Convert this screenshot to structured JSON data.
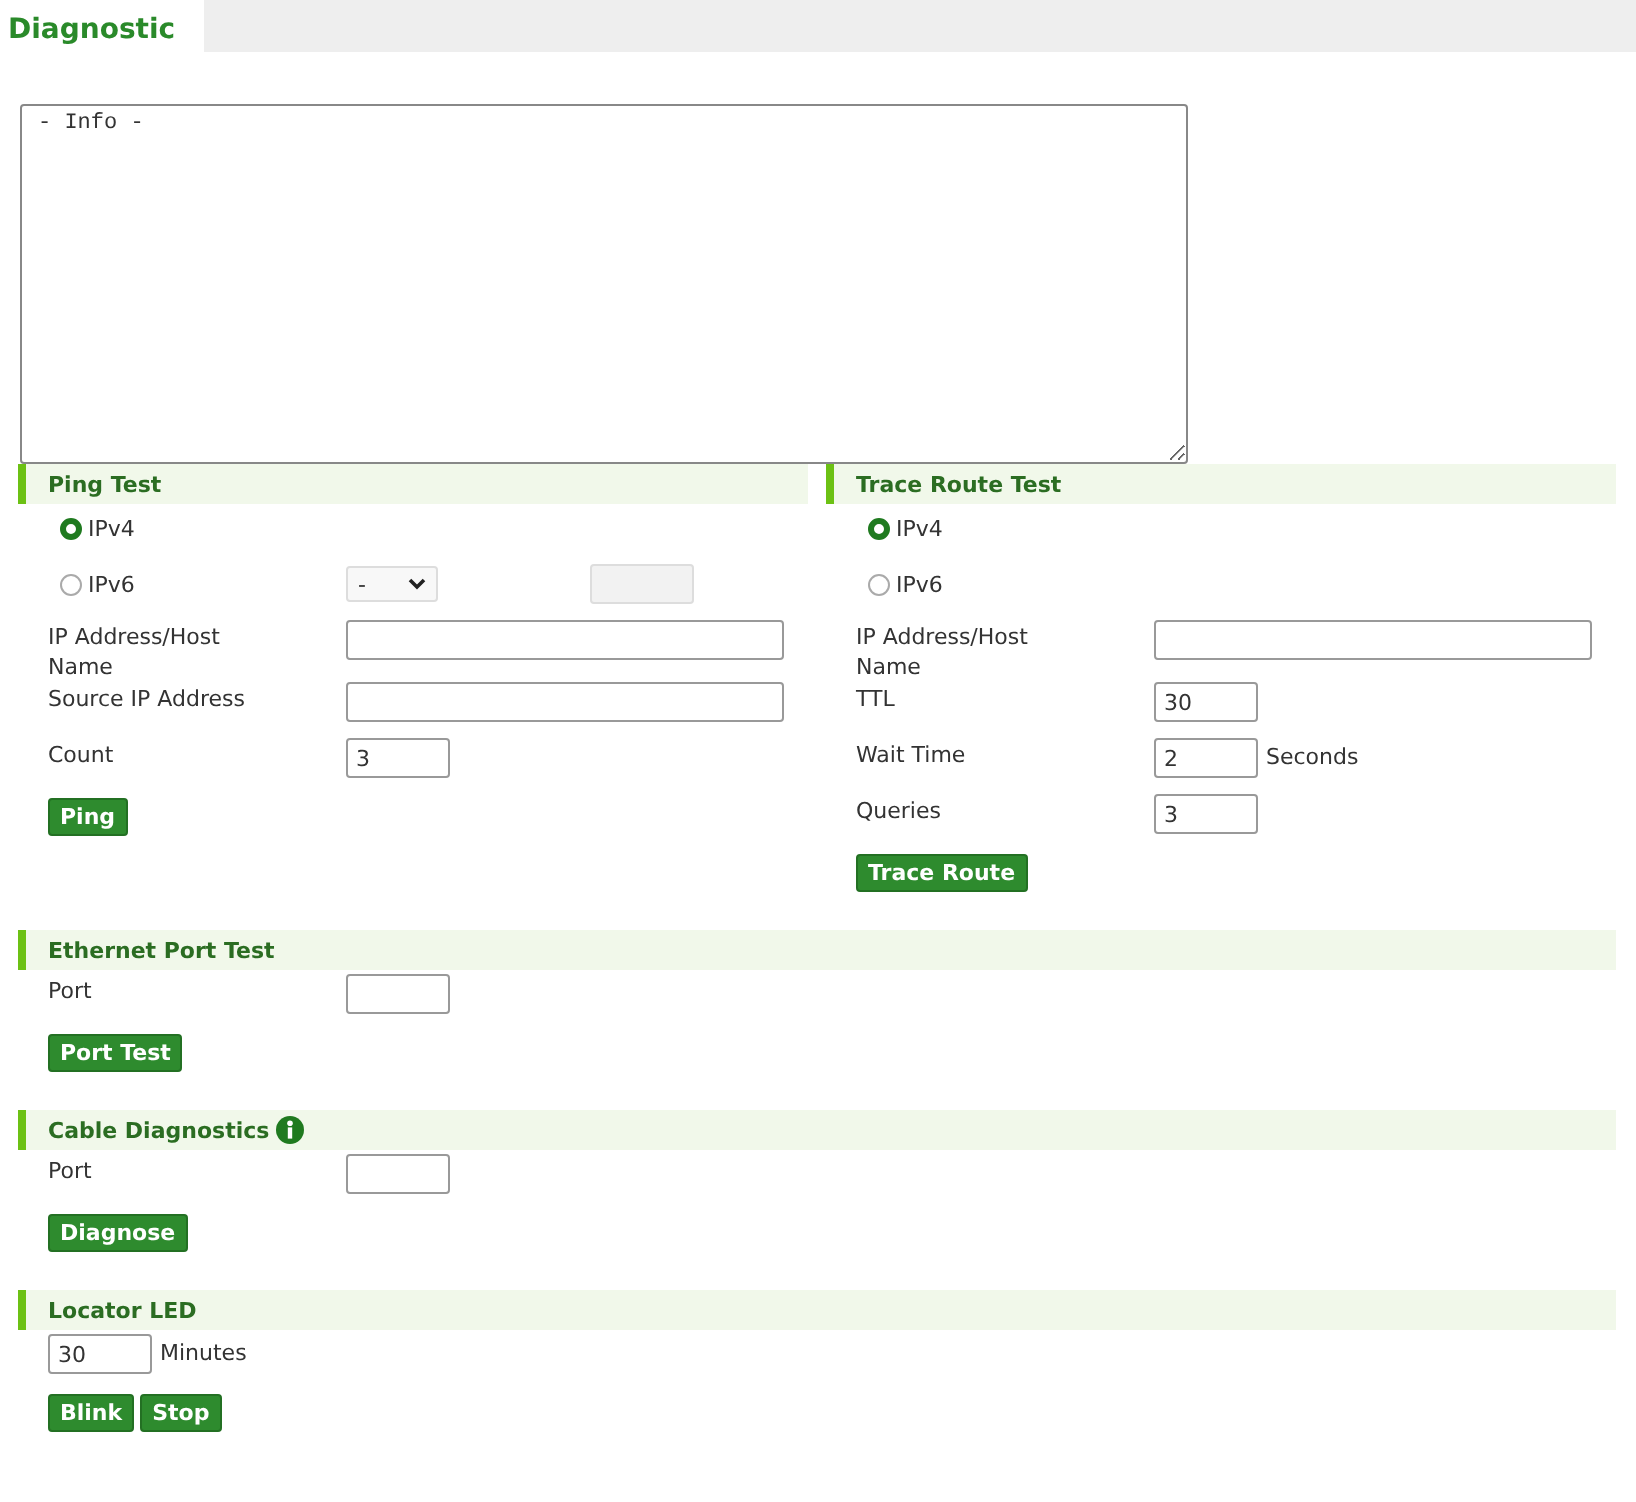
{
  "tab": {
    "label": "Diagnostic",
    "selected": true
  },
  "info": {
    "value": "- Info -"
  },
  "panels": [
    {
      "sections": [
        {
          "title": "Ping Test",
          "rows": [
            {
              "kind": "radio",
              "label": "IPv4",
              "selected": true
            },
            {
              "kind": "radio",
              "label": "IPv6",
              "selected": false,
              "select": {
                "value": "-"
              },
              "extra_field": {
                "disabled": true
              }
            },
            {
              "kind": "wide-field",
              "label": "IP Address/Host Name"
            },
            {
              "kind": "wide-field",
              "label": "Source IP Address"
            },
            {
              "kind": "short-field",
              "label": "Count",
              "value": "3"
            },
            {
              "kind": "buttons",
              "buttons": [
                "Ping"
              ]
            }
          ]
        },
        {
          "title": "Trace Route Test",
          "rows": [
            {
              "kind": "radio",
              "label": "IPv4",
              "selected": true
            },
            {
              "kind": "radio",
              "label": "IPv6",
              "selected": false
            },
            {
              "kind": "wide-field",
              "label": "IP Address/Host Name"
            },
            {
              "kind": "short-field",
              "label": "TTL",
              "value": "30"
            },
            {
              "kind": "short-field",
              "label": "Wait Time",
              "value": "2",
              "unit": "Seconds"
            },
            {
              "kind": "short-field",
              "label": "Queries",
              "value": "3"
            },
            {
              "kind": "buttons",
              "buttons": [
                "Trace Route"
              ]
            }
          ]
        }
      ]
    },
    {
      "sections": [
        {
          "title": "Ethernet Port Test",
          "rows": [
            {
              "kind": "short-field",
              "label": "Port"
            },
            {
              "kind": "buttons",
              "buttons": [
                "Port Test"
              ]
            }
          ]
        }
      ]
    },
    {
      "sections": [
        {
          "title": "Cable Diagnostics",
          "info_icon": true,
          "rows": [
            {
              "kind": "short-field",
              "label": "Port"
            },
            {
              "kind": "buttons",
              "buttons": [
                "Diagnose"
              ]
            }
          ]
        }
      ]
    },
    {
      "sections": [
        {
          "title": "Locator LED",
          "rows": [
            {
              "kind": "short-field",
              "value": "30",
              "unit": "Minutes"
            },
            {
              "kind": "buttons",
              "buttons": [
                "Blink",
                "Stop"
              ]
            }
          ]
        }
      ]
    }
  ]
}
